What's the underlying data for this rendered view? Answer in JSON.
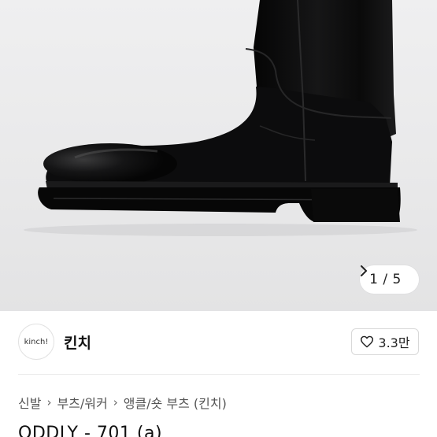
{
  "gallery": {
    "current": "1",
    "separator": "/",
    "total": "5",
    "next_icon": "chevron-right-icon"
  },
  "seller": {
    "avatar_text": "kinch!",
    "name": "킨치",
    "like_icon": "heart-outline-icon",
    "like_count": "3.3만"
  },
  "breadcrumb": {
    "items": [
      "신발",
      "부츠/워커",
      "앵클/숏 부츠 (킨치)"
    ],
    "separator_icon": "chevron-right-icon"
  },
  "product": {
    "title": "ODDLY - 701 (a)"
  },
  "colors": {
    "background": "#ffffff",
    "image_bg": "#ececed",
    "boot": "#0d0d0e",
    "text": "#111111",
    "muted_text": "#555555"
  }
}
